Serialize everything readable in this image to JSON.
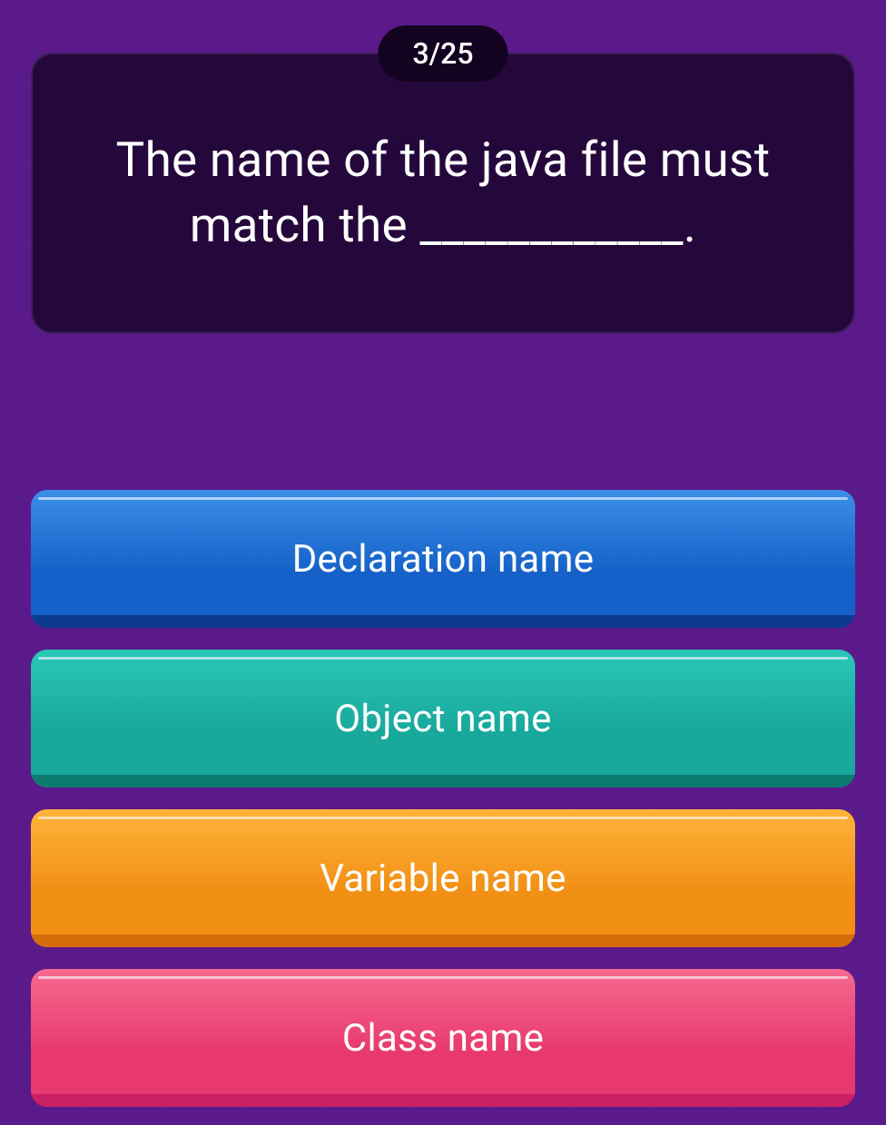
{
  "counter": "3/25",
  "question": "The name of the java file must match the ____________.",
  "answers": {
    "0": "Declaration name",
    "1": "Object name",
    "2": "Variable name",
    "3": "Class name"
  }
}
